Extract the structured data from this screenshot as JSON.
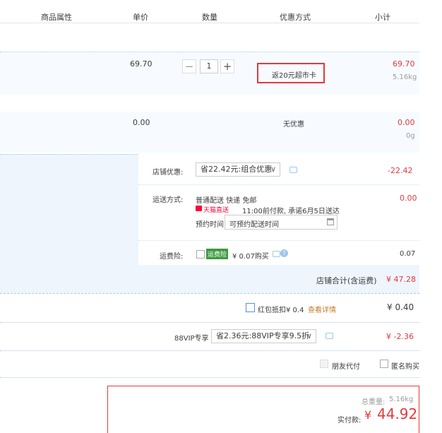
{
  "header": {
    "attributes": "商品属性",
    "unit_price": "单价",
    "quantity": "数量",
    "discount": "优惠方式",
    "subtotal": "小计"
  },
  "item1": {
    "price": "69.70",
    "quantity": "1",
    "minus": "−",
    "plus": "+",
    "promo": "返20元超市卡",
    "subtotal": "69.70",
    "weight": "5.16kg"
  },
  "item2": {
    "price": "0.00",
    "promo": "无优惠",
    "subtotal": "0.00",
    "weight": "0g"
  },
  "shop": {
    "discount_label": "店铺优惠:",
    "discount_select": "省22.42元:组合优惠",
    "discount_amount": "-22.42",
    "shipping_label": "运送方式:",
    "shipping_method": "普通配送 快递 免邮",
    "tmall_badge": "天猫直送",
    "delivery_note": "11:00前付款, 承诺6月5日送达",
    "appointment_label": "预约时间",
    "appointment_value": "可预约配送时间",
    "shipping_cost": "0.00",
    "insurance_label": "运费险:",
    "insurance_badge": "运费险",
    "insurance_text": "¥ 0.07购买",
    "insurance_amount": "0.07",
    "total_label": "店铺合计(含运费)",
    "total_amount": "¥ 47.28"
  },
  "redpacket": {
    "text": "红包抵扣¥ 0.4",
    "link": "查看详情",
    "amount": "¥ 0.40"
  },
  "vip": {
    "label": "88VIP专享",
    "select": "省2.36元:88VIP专享9.5折",
    "amount": "¥ -2.36"
  },
  "options": {
    "friend_pay": "朋友代付",
    "anonymous": "匿名购买"
  },
  "summary": {
    "weight_label": "总重量:",
    "weight_value": "5.16kg",
    "paid_label": "实付款:",
    "currency": "¥",
    "paid_value": "44.92"
  },
  "colors": {
    "accent_red": "#e4393c",
    "tmall_red": "#ff0036",
    "insurance_green": "#3d9b3d",
    "link_orange": "#c47d2a"
  }
}
